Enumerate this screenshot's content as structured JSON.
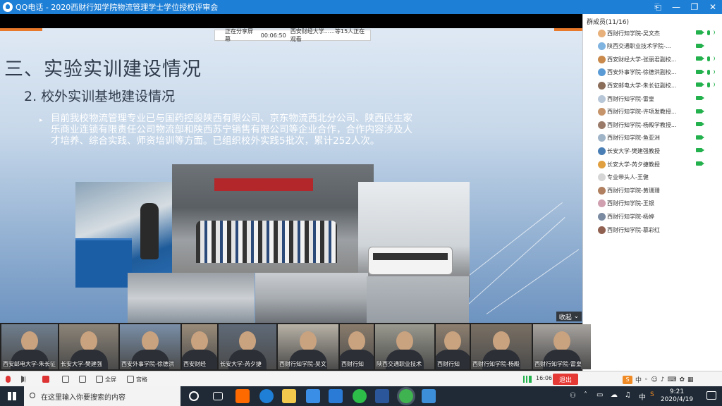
{
  "window": {
    "title": "QQ电话 - 2020西财行知学院物流管理学士学位授权评审会",
    "icons": [
      "qq-icon",
      "pin-icon",
      "minimize-icon",
      "maximize-icon",
      "close-icon"
    ]
  },
  "share_bar": {
    "status": "正在分享屏幕",
    "elapsed": "00:06:50",
    "viewers": "西安财经大学......等15人正在观看"
  },
  "slide": {
    "title": "三、实验实训建设情况",
    "subtitle": "2. 校外实训基地建设情况",
    "bullet": "▸",
    "paragraph": "目前我校物流管理专业已与国药控股陕西有限公司、京东物流西北分公司、陕西民生家乐商业连锁有限责任公司物流部和陕西苏宁销售有限公司等企业合作，合作内容涉及人才培养、综合实践、师资培训等方面。已组织校外实践5批次，累计252人次。",
    "collapse_label": "收起"
  },
  "members": {
    "header": "群成员(11/16)",
    "items": [
      {
        "name": "西财行知学院-吴文杰",
        "avatar": "#e8b07a"
      },
      {
        "name": "陕西交通职业技术学院-...",
        "avatar": "#7fb3e0"
      },
      {
        "name": "西安财经大学-张丽君副校...",
        "avatar": "#c98a4b"
      },
      {
        "name": "西安外事学院-徐德洪副校...",
        "avatar": "#5b9bd5"
      },
      {
        "name": "西安邮电大学-朱长征副校...",
        "avatar": "#8a6e5a"
      },
      {
        "name": "西财行知学院-雷皇",
        "avatar": "#b7c7d8"
      },
      {
        "name": "西财行知学院-许项发教授...",
        "avatar": "#c6946a"
      },
      {
        "name": "西财行知学院-杨殿学教授...",
        "avatar": "#9a7b6a"
      },
      {
        "name": "西财行知学院-鱼亚洲",
        "avatar": "#a0b4c8"
      },
      {
        "name": "长安大学-樊建强教授",
        "avatar": "#4a7fb5"
      },
      {
        "name": "长安大学-芮夕捷教授",
        "avatar": "#e0a040"
      },
      {
        "name": "专业带头人-王健",
        "avatar": "#d6d6d6"
      },
      {
        "name": "西财行知学院-黄珊珊",
        "avatar": "#b08060"
      },
      {
        "name": "西财行知学院-王银",
        "avatar": "#d0a0b0"
      },
      {
        "name": "西财行知学院-杨婷",
        "avatar": "#7a8aa0"
      },
      {
        "name": "西财行知学院-慕彩红",
        "avatar": "#906050"
      }
    ]
  },
  "videos": [
    {
      "label": "西安邮电大学-朱长征"
    },
    {
      "label": "长安大学-樊建强"
    },
    {
      "label": "西安外事学院-徐德洪"
    },
    {
      "label": "西安财经"
    },
    {
      "label": "长安大学-芮夕捷"
    },
    {
      "label": "西财行知学院-吴文"
    },
    {
      "label": "西财行知"
    },
    {
      "label": "陕西交通职业技术"
    },
    {
      "label": "西财行知"
    },
    {
      "label": "西财行知学院-杨殿"
    },
    {
      "label": "西财行知学院-雷皇"
    }
  ],
  "controls": {
    "fullscreen": "全屏",
    "gallery": "宫格",
    "timer": "16:06",
    "leave": "退出",
    "ime_lang": "中"
  },
  "taskbar": {
    "search_placeholder": "在这里输入你要搜索的内容",
    "clock_time": "9:21",
    "clock_date": "2020/4/19",
    "app_icons": [
      "cortana-icon",
      "task-view-icon",
      "mi-icon",
      "edge-icon",
      "explorer-icon",
      "store-icon",
      "mail-icon",
      "wechat-icon",
      "word-icon",
      "qq-call-icon",
      "photos-icon"
    ]
  }
}
